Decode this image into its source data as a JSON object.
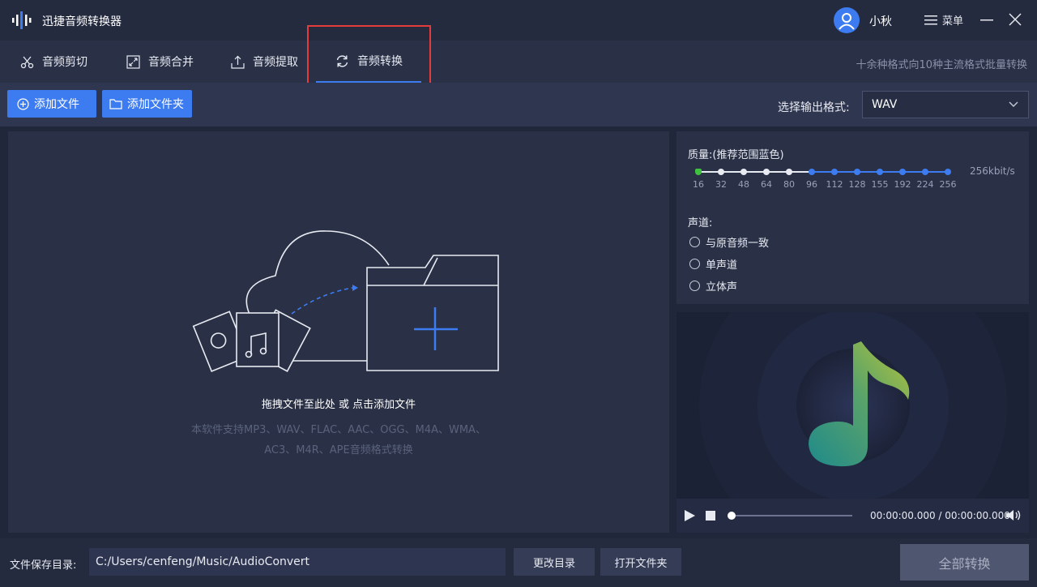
{
  "app": {
    "title": "迅捷音频转换器"
  },
  "user": {
    "name": "小秋"
  },
  "window": {
    "menu_label": "菜单"
  },
  "tabs": [
    {
      "label": "音频剪切",
      "icon": "scissors-icon"
    },
    {
      "label": "音频合并",
      "icon": "merge-icon"
    },
    {
      "label": "音频提取",
      "icon": "extract-icon"
    },
    {
      "label": "音频转换",
      "icon": "convert-icon",
      "active": true
    }
  ],
  "tab_hint": "十余种格式向10种主流格式批量转换",
  "toolbar": {
    "add_file": "添加文件",
    "add_folder": "添加文件夹",
    "format_label": "选择输出格式:",
    "format_value": "WAV"
  },
  "dropzone": {
    "main_text": "拖拽文件至此处 或 点击添加文件",
    "sub_text_line1": "本软件支持MP3、WAV、FLAC、AAC、OGG、M4A、WMA、",
    "sub_text_line2": "AC3、M4R、APE音频格式转换"
  },
  "quality": {
    "label": "质量:(推荐范围蓝色)",
    "ticks": [
      "16",
      "32",
      "48",
      "64",
      "80",
      "96",
      "112",
      "128",
      "155",
      "192",
      "224",
      "256"
    ],
    "selected": "256",
    "value_text": "256kbit/s"
  },
  "channel": {
    "label": "声道:",
    "options": [
      "与原音频一致",
      "单声道",
      "立体声"
    ]
  },
  "player": {
    "time": "00:00:00.000 / 00:00:00.000",
    "progress": 0
  },
  "bottom": {
    "save_label": "文件保存目录:",
    "path": "C:/Users/cenfeng/Music/AudioConvert",
    "change_dir": "更改目录",
    "open_folder": "打开文件夹",
    "convert_all": "全部转换"
  },
  "colors": {
    "accent": "#3d7cf0",
    "highlight": "#e23c3c",
    "green": "#3ec13e"
  }
}
